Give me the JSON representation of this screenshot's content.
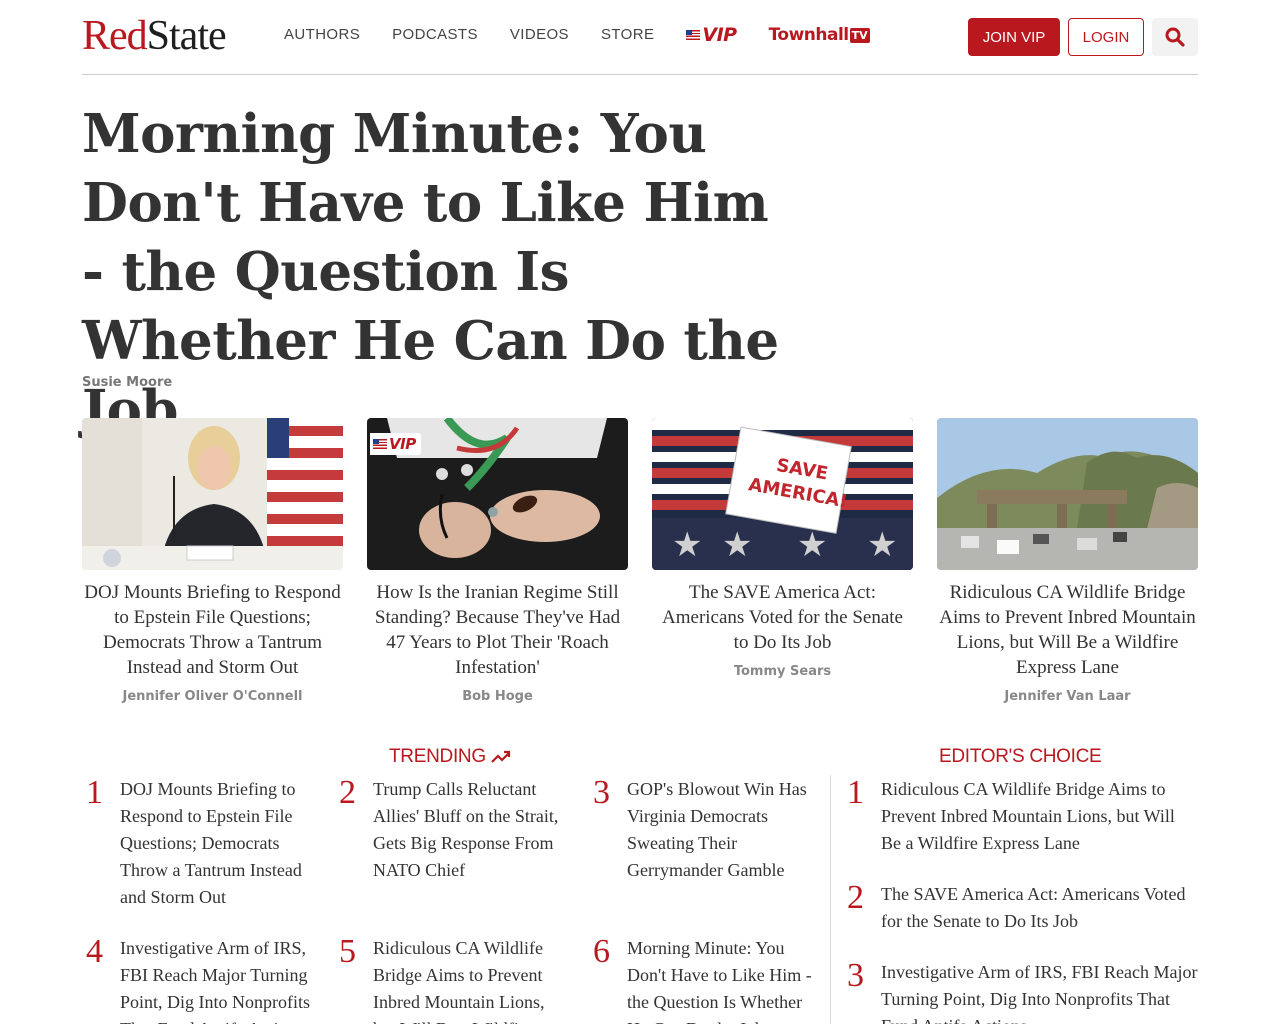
{
  "header": {
    "logo_red": "Red",
    "logo_dark": "State",
    "nav": [
      "AUTHORS",
      "PODCASTS",
      "VIDEOS",
      "STORE"
    ],
    "vip_label": "VIP",
    "townhall_label": "Townhall",
    "townhall_tv": "TV",
    "join_label": "JOIN VIP",
    "login_label": "LOGIN"
  },
  "main": {
    "headline": "Morning Minute: You Don't Have to Like Him - the Question Is Whether He Can Do the Job",
    "author": "Susie Moore"
  },
  "cards": [
    {
      "title": "DOJ Mounts Briefing to Respond to Epstein File Questions; Democrats Throw a Tantrum Instead and Storm Out",
      "author": "Jennifer Oliver O'Connell"
    },
    {
      "title": "How Is the Iranian Regime Still Standing? Because They've Had 47 Years to Plot Their 'Roach Infestation'",
      "author": "Bob Hoge",
      "badge": "VIP"
    },
    {
      "title": "The SAVE America Act: Americans Voted for the Senate to Do Its Job",
      "author": "Tommy Sears",
      "sign_text": "SAVE AMERICA!"
    },
    {
      "title": "Ridiculous CA Wildlife Bridge Aims to Prevent Inbred Mountain Lions, but Will Be a Wildfire Express Lane",
      "author": "Jennifer Van Laar"
    }
  ],
  "trending": {
    "heading": "TRENDING",
    "items": [
      {
        "num": "1",
        "title": "DOJ Mounts Briefing to Respond to Epstein File Questions; Democrats Throw a Tantrum Instead and Storm Out"
      },
      {
        "num": "2",
        "title": "Trump Calls Reluctant Allies' Bluff on the Strait, Gets Big Response From NATO Chief"
      },
      {
        "num": "3",
        "title": "GOP's Blowout Win Has Virginia Democrats Sweating Their Gerrymander Gamble"
      },
      {
        "num": "4",
        "title": "Investigative Arm of IRS, FBI Reach Major Turning Point, Dig Into Nonprofits That Fund Antifa Actions"
      },
      {
        "num": "5",
        "title": "Ridiculous CA Wildlife Bridge Aims to Prevent Inbred Mountain Lions, but Will Be a Wildfire Express Lane"
      },
      {
        "num": "6",
        "title": "Morning Minute: You Don't Have to Like Him - the Question Is Whether He Can Do the Job"
      }
    ]
  },
  "editors": {
    "heading": "EDITOR'S CHOICE",
    "items": [
      {
        "num": "1",
        "title": "Ridiculous CA Wildlife Bridge Aims to Prevent Inbred Mountain Lions, but Will Be a Wildfire Express Lane"
      },
      {
        "num": "2",
        "title": "The SAVE America Act: Americans Voted for the Senate to Do Its Job"
      },
      {
        "num": "3",
        "title": "Investigative Arm of IRS, FBI Reach Major Turning Point, Dig Into Nonprofits That Fund Antifa Actions"
      }
    ]
  },
  "colors": {
    "brand_red": "#b8181e",
    "text_dark": "#333333",
    "muted": "#888888"
  }
}
